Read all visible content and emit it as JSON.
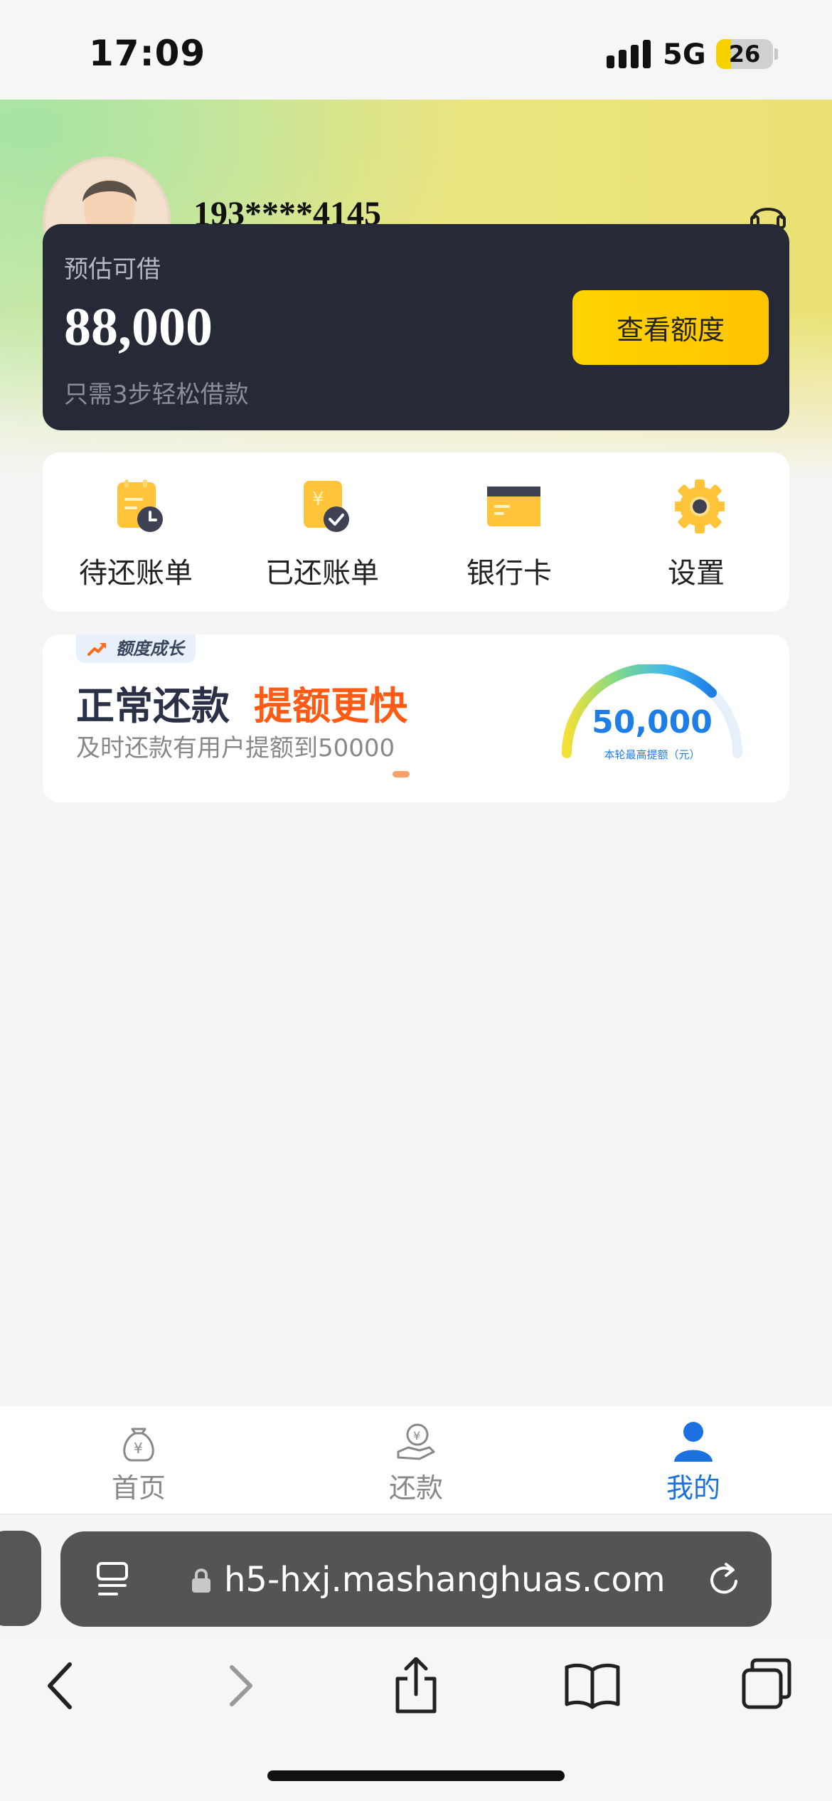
{
  "status_bar": {
    "time": "17:09",
    "network": "5G",
    "battery_level": "26",
    "battery_fraction": 0.26
  },
  "profile": {
    "phone": "193****4145",
    "support_icon": "headset-icon"
  },
  "loan_card": {
    "label": "预估可借",
    "amount": "88,000",
    "subtitle": "只需3步轻松借款",
    "button_label": "查看额度"
  },
  "quick_menu": [
    {
      "label": "待还账单",
      "icon": "pending-bill-icon"
    },
    {
      "label": "已还账单",
      "icon": "paid-bill-icon"
    },
    {
      "label": "银行卡",
      "icon": "bank-card-icon"
    },
    {
      "label": "设置",
      "icon": "gear-icon"
    }
  ],
  "promo": {
    "tag": "额度成长",
    "title": "正常还款",
    "title_highlight": "提额更快",
    "description": "及时还款有用户提额到50000",
    "gauge_value": "50,000",
    "gauge_caption": "本轮最高提额（元）"
  },
  "tab_bar": [
    {
      "label": "首页",
      "icon": "money-bag-icon",
      "active": false
    },
    {
      "label": "还款",
      "icon": "repay-icon",
      "active": false
    },
    {
      "label": "我的",
      "icon": "person-icon",
      "active": true
    }
  ],
  "browser": {
    "url": "h5-hxj.mashanghuas.com"
  },
  "colors": {
    "accent_yellow": "#FFD400",
    "card_dark": "#262A37",
    "highlight_orange": "#FF5A16",
    "active_blue": "#1B71E0"
  }
}
